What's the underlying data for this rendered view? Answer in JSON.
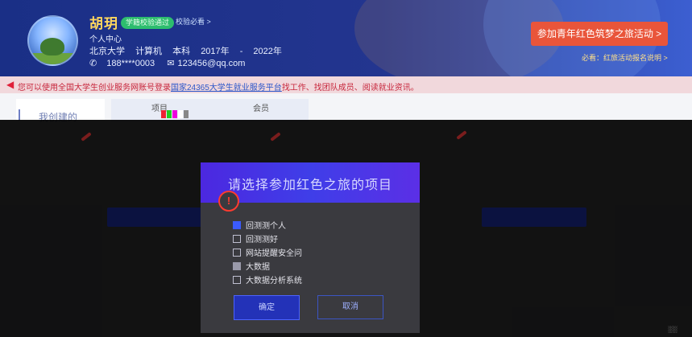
{
  "profile": {
    "name": "胡玥",
    "badge": "学籍校验通过",
    "badge_link": "校验必看 >",
    "center_label": "个人中心",
    "school": "北京大学",
    "major": "计算机",
    "degree": "本科",
    "years": "2017年 - 2022年",
    "phone": "188****0003",
    "email": "123456@qq.com"
  },
  "activity": {
    "button": "参加青年红色筑梦之旅活动  >",
    "note": "必看：红旅活动报名说明 >"
  },
  "notice": {
    "prefix": "您可以使用全国大学生创业服务网账号登录",
    "link": "国家24365大学生就业服务平台",
    "suffix": "找工作、找团队成员、阅读就业资讯。"
  },
  "tabs": {
    "mine": "我创建的",
    "project_col": "项目",
    "member_col": "会员"
  },
  "modal": {
    "title": "请选择参加红色之旅的项目",
    "options": [
      {
        "label": "回测测个人",
        "state": "checked"
      },
      {
        "label": "回测测好",
        "state": "unchecked"
      },
      {
        "label": "网站提醒安全问",
        "state": "unchecked"
      },
      {
        "label": "大数据",
        "state": "indeterminate"
      },
      {
        "label": "大数据分析系统",
        "state": "unchecked"
      }
    ],
    "confirm": "确定",
    "cancel": "取消"
  },
  "colors": {
    "header_start": "#1a2f86",
    "header_end": "#3c5fd1",
    "accent_orange": "#e9553a",
    "modal_head": "#4c28e0",
    "primary_blue": "#2845c9",
    "notice_red": "#c7263c"
  }
}
